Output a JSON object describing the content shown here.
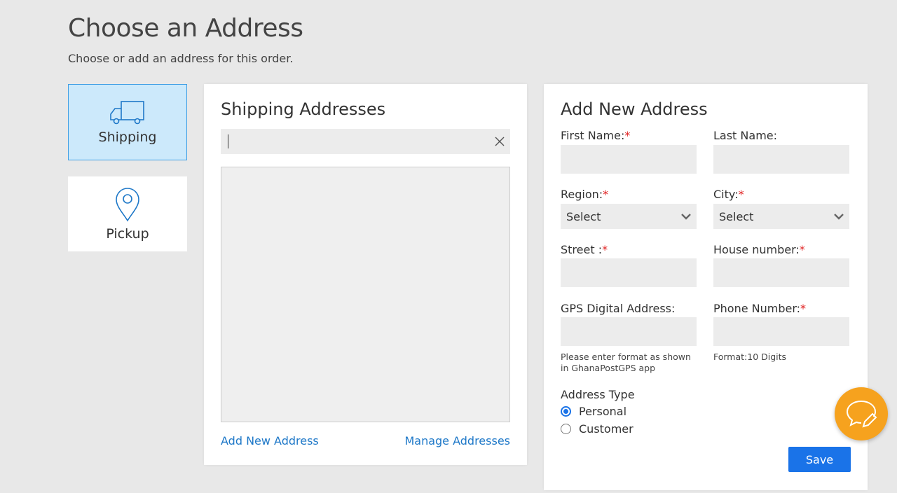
{
  "header": {
    "title": "Choose an Address",
    "subtitle": "Choose or add an address for this order."
  },
  "methods": [
    {
      "label": "Shipping",
      "icon": "truck-icon",
      "selected": true
    },
    {
      "label": "Pickup",
      "icon": "location-pin-icon",
      "selected": false
    }
  ],
  "shipping_panel": {
    "title": "Shipping Addresses",
    "search": {
      "value": "",
      "placeholder": ""
    },
    "add_link": "Add New Address",
    "manage_link": "Manage Addresses"
  },
  "new_address": {
    "title": "Add New Address",
    "first_name": {
      "label": "First Name:",
      "required": "*",
      "value": ""
    },
    "last_name": {
      "label": "Last Name:",
      "value": ""
    },
    "region": {
      "label": "Region:",
      "required": "*",
      "selected": "Select"
    },
    "city": {
      "label": "City:",
      "required": "*",
      "selected": "Select"
    },
    "street": {
      "label": "Street :",
      "required": "*",
      "value": ""
    },
    "house_number": {
      "label": "House number:",
      "required": "*",
      "value": ""
    },
    "gps": {
      "label": "GPS Digital Address:",
      "value": "",
      "hint": "Please enter format as shown in GhanaPostGPS app"
    },
    "phone": {
      "label": "Phone Number:",
      "required": "*",
      "value": "",
      "hint": "Format:10 Digits"
    },
    "address_type": {
      "label": "Address Type",
      "options": [
        {
          "label": "Personal",
          "checked": true
        },
        {
          "label": "Customer",
          "checked": false
        }
      ]
    },
    "save_label": "Save"
  },
  "colors": {
    "accent": "#1a73e8",
    "link": "#1e78c8",
    "tile_selected_bg": "#cce9fb",
    "tile_selected_border": "#3f9ee4",
    "required": "#e02020",
    "chat_fab": "#f6a21e"
  },
  "chat_button": {
    "icon": "chat-edit-icon"
  }
}
